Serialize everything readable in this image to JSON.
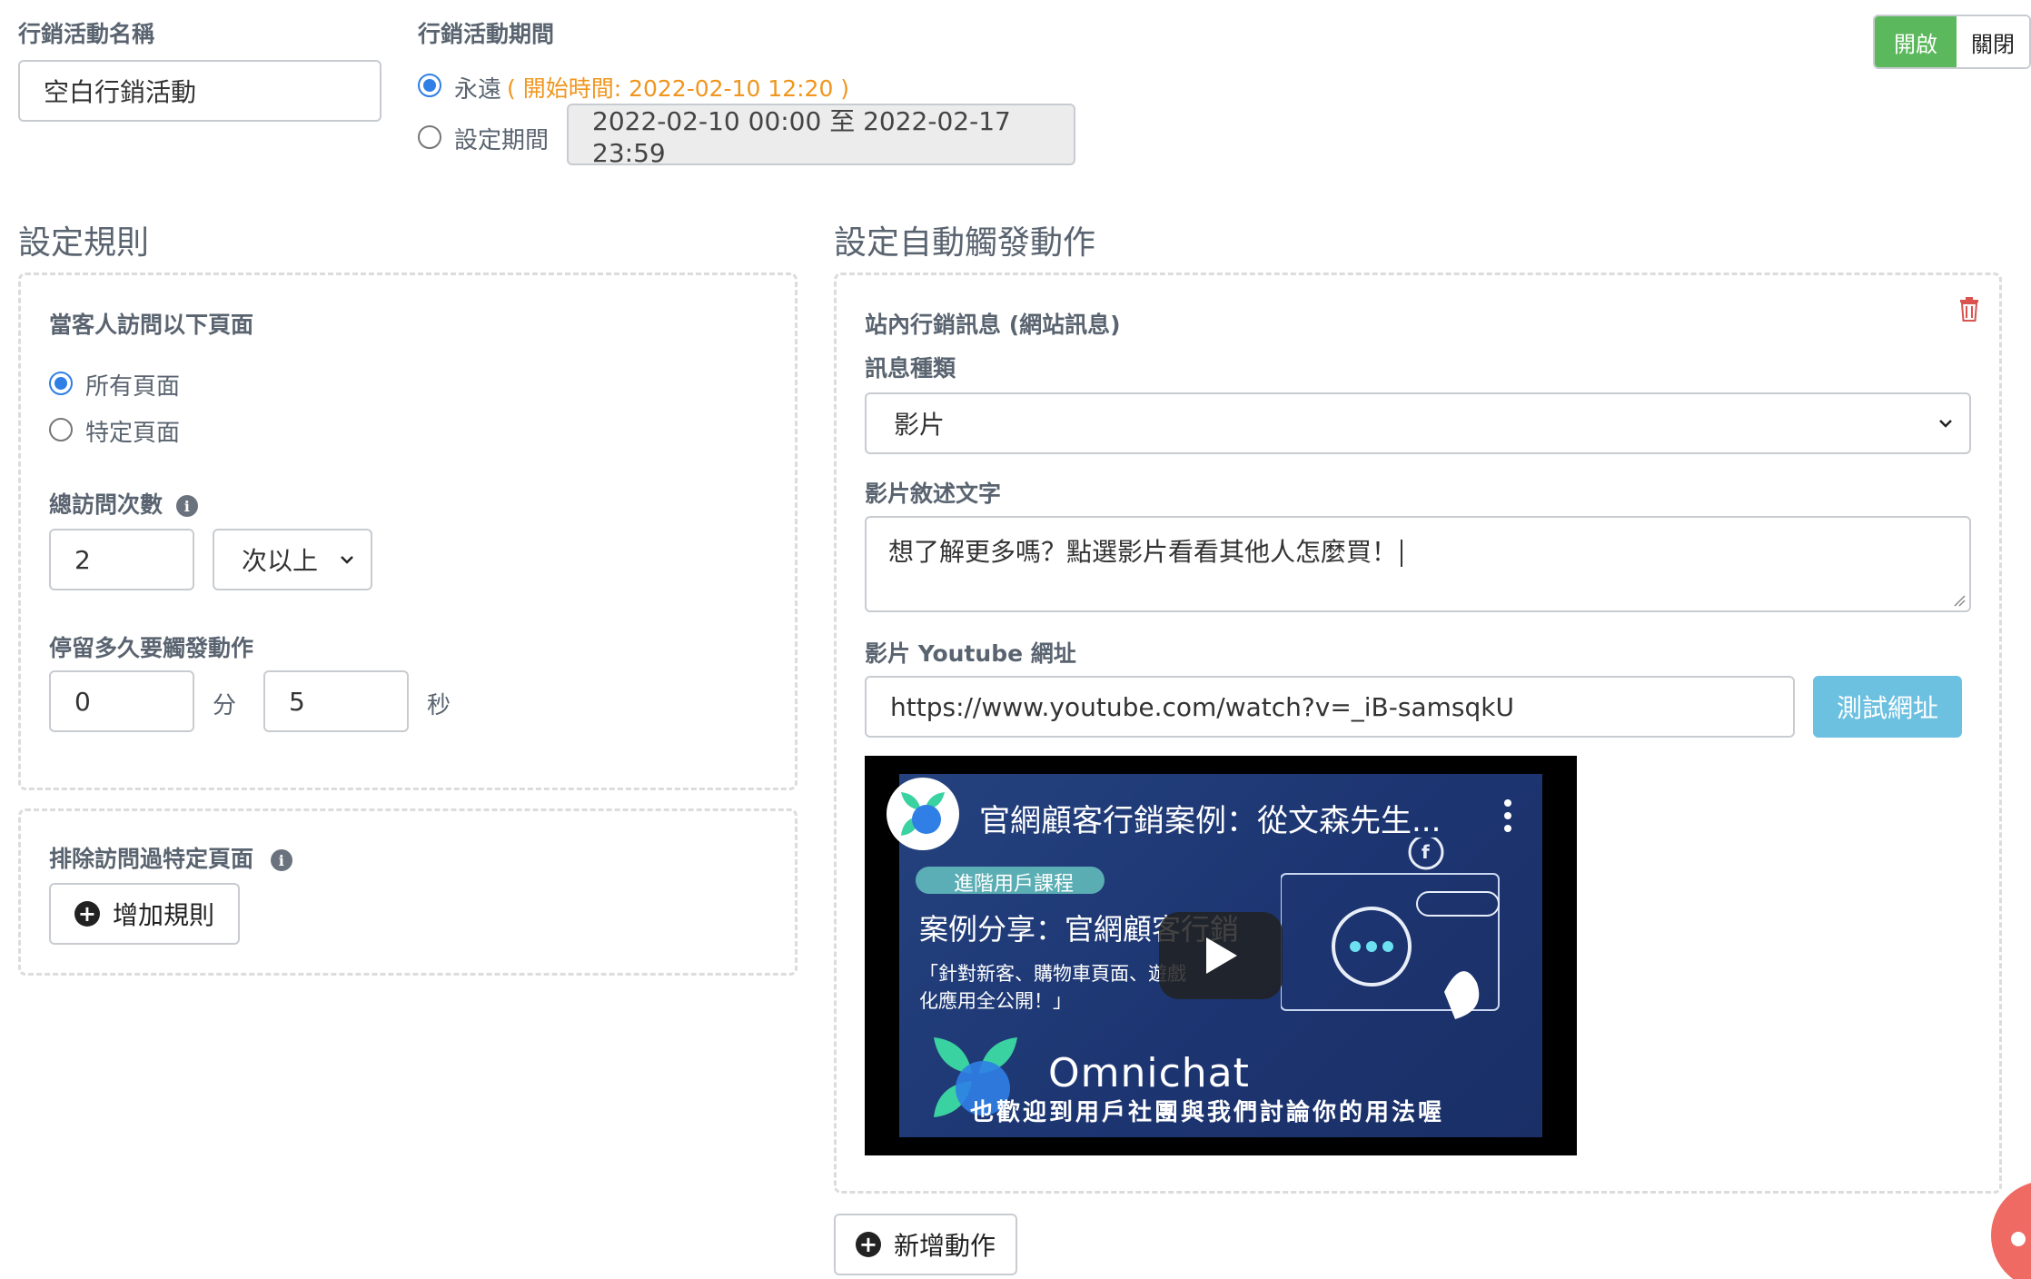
{
  "campaign": {
    "name_label": "行銷活動名稱",
    "name_value": "空白行銷活動",
    "period_label": "行銷活動期間",
    "forever_label": "永遠",
    "forever_note": "( 開始時間: 2022-02-10 12:20 )",
    "set_period_label": "設定期間",
    "period_range": "2022-02-10 00:00 至 2022-02-17 23:59",
    "toggle_on": "開啟",
    "toggle_off": "關閉"
  },
  "rules": {
    "title": "設定規則",
    "visit_heading": "當客人訪問以下頁面",
    "all_pages": "所有頁面",
    "specific_pages": "特定頁面",
    "total_visits_label": "總訪問次數",
    "visits_value": "2",
    "visits_select": "次以上",
    "stay_label": "停留多久要觸發動作",
    "minutes_value": "0",
    "minutes_unit": "分",
    "seconds_value": "5",
    "seconds_unit": "秒",
    "exclude_label": "排除訪問過特定頁面",
    "add_rule_button": "增加規則"
  },
  "actions": {
    "title": "設定自動觸發動作",
    "card_title": "站內行銷訊息 (網站訊息)",
    "message_type_label": "訊息種類",
    "message_type_value": "影片",
    "video_desc_label": "影片敘述文字",
    "video_desc_value": "想了解更多嗎？點選影片看看其他人怎麼買！",
    "youtube_label": "影片 Youtube 網址",
    "youtube_url": "https://www.youtube.com/watch?v=_iB-samsqkU",
    "test_url_button": "測試網址",
    "add_action_button": "新增動作"
  },
  "video": {
    "title": "官網顧客行銷案例：從文森先生...",
    "tag": "進階用戶課程",
    "headline": "案例分享：官網顧客行銷",
    "subtext_line1": "「針對新客、購物車頁面、遊戲",
    "subtext_line2": "化應用全公開！」",
    "brand": "Omnichat",
    "caption": "也歡迎到用戶社團與我們討論你的用法喔"
  },
  "colors": {
    "accent_blue": "#2f7fe6",
    "green_on": "#5cb85c",
    "orange_note": "#f0961e",
    "test_button": "#6cc0e0",
    "video_bg": "#1f3a7a",
    "delete_red": "#d9534f"
  }
}
